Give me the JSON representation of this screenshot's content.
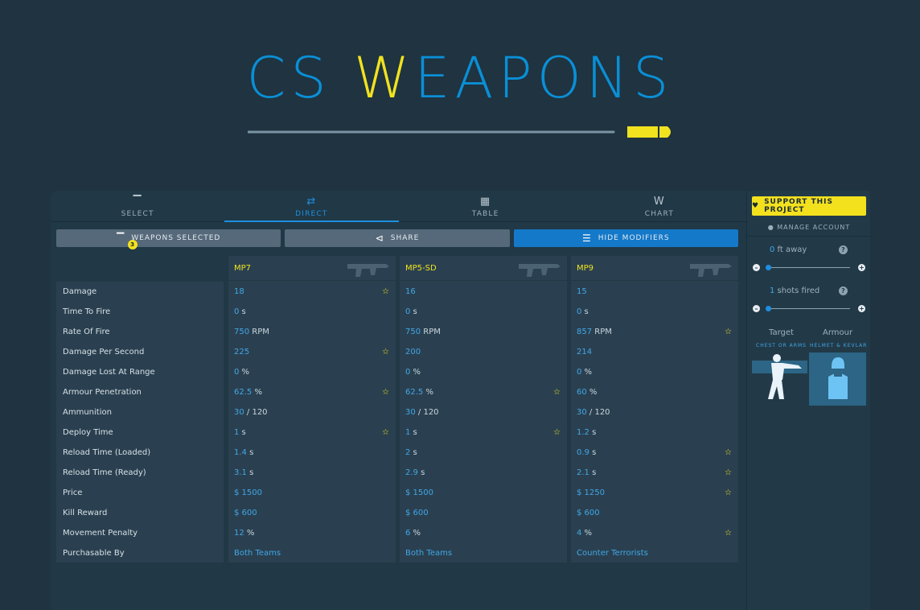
{
  "logo": {
    "part1": "CS ",
    "part2": "W",
    "part3": "EAPONS"
  },
  "tabs": [
    {
      "label": "SELECT",
      "icon": "pistol-icon"
    },
    {
      "label": "DIRECT",
      "icon": "swap-icon"
    },
    {
      "label": "TABLE",
      "icon": "grid-icon"
    },
    {
      "label": "CHART",
      "icon": "chart-w-icon"
    }
  ],
  "active_tab": "DIRECT",
  "actions": {
    "weapons_selected": "WEAPONS SELECTED",
    "weapons_count": "3",
    "share": "SHARE",
    "hide_modifiers": "HIDE MODIFIERS"
  },
  "labels": [
    "Damage",
    "Time To Fire",
    "Rate Of Fire",
    "Damage Per Second",
    "Damage Lost At Range",
    "Armour Penetration",
    "Ammunition",
    "Deploy Time",
    "Reload Time (Loaded)",
    "Reload Time (Ready)",
    "Price",
    "Kill Reward",
    "Movement Penalty",
    "Purchasable By"
  ],
  "weapons": [
    {
      "name": "MP7",
      "rows": [
        {
          "v": "18",
          "u": "",
          "star": true
        },
        {
          "v": "0",
          "u": " s",
          "star": false
        },
        {
          "v": "750",
          "u": " RPM",
          "star": false
        },
        {
          "v": "225",
          "u": "",
          "star": true
        },
        {
          "v": "0",
          "u": " %",
          "star": false
        },
        {
          "v": "62.5",
          "u": " %",
          "star": true
        },
        {
          "v": "30",
          "u": " / 120",
          "star": false
        },
        {
          "v": "1",
          "u": " s",
          "star": true
        },
        {
          "v": "1.4",
          "u": " s",
          "star": false
        },
        {
          "v": "3.1",
          "u": " s",
          "star": false
        },
        {
          "v": "$ 1500",
          "u": "",
          "star": false,
          "pre": true
        },
        {
          "v": "$ 600",
          "u": "",
          "star": false,
          "pre": true
        },
        {
          "v": "12",
          "u": " %",
          "star": false
        },
        {
          "v": "Both Teams",
          "u": "",
          "star": false
        }
      ]
    },
    {
      "name": "MP5-SD",
      "rows": [
        {
          "v": "16",
          "u": "",
          "star": false
        },
        {
          "v": "0",
          "u": " s",
          "star": false
        },
        {
          "v": "750",
          "u": " RPM",
          "star": false
        },
        {
          "v": "200",
          "u": "",
          "star": false
        },
        {
          "v": "0",
          "u": " %",
          "star": false
        },
        {
          "v": "62.5",
          "u": " %",
          "star": true
        },
        {
          "v": "30",
          "u": " / 120",
          "star": false
        },
        {
          "v": "1",
          "u": " s",
          "star": true
        },
        {
          "v": "2",
          "u": " s",
          "star": false
        },
        {
          "v": "2.9",
          "u": " s",
          "star": false
        },
        {
          "v": "$ 1500",
          "u": "",
          "star": false
        },
        {
          "v": "$ 600",
          "u": "",
          "star": false
        },
        {
          "v": "6",
          "u": " %",
          "star": false
        },
        {
          "v": "Both Teams",
          "u": "",
          "star": false
        }
      ]
    },
    {
      "name": "MP9",
      "rows": [
        {
          "v": "15",
          "u": "",
          "star": false
        },
        {
          "v": "0",
          "u": " s",
          "star": false
        },
        {
          "v": "857",
          "u": " RPM",
          "star": true
        },
        {
          "v": "214",
          "u": "",
          "star": false
        },
        {
          "v": "0",
          "u": " %",
          "star": false
        },
        {
          "v": "60",
          "u": " %",
          "star": false
        },
        {
          "v": "30",
          "u": " / 120",
          "star": false
        },
        {
          "v": "1.2",
          "u": " s",
          "star": false
        },
        {
          "v": "0.9",
          "u": " s",
          "star": true
        },
        {
          "v": "2.1",
          "u": " s",
          "star": true
        },
        {
          "v": "$ 1250",
          "u": "",
          "star": true
        },
        {
          "v": "$ 600",
          "u": "",
          "star": false
        },
        {
          "v": "4",
          "u": " %",
          "star": true
        },
        {
          "v": "Counter Terrorists",
          "u": "",
          "star": false
        }
      ]
    }
  ],
  "side": {
    "support": "SUPPORT THIS PROJECT",
    "manage_account": "MANAGE ACCOUNT",
    "distance_value": "0",
    "distance_unit": " ft away",
    "shots_value": "1",
    "shots_unit": " shots fired",
    "target_label": "Target",
    "armour_label": "Armour",
    "target_caption": "CHEST OR ARMS",
    "armour_caption": "HELMET & KEVLAR"
  },
  "colors": {
    "accent": "#1d8fe0",
    "highlight": "#f0e21f",
    "background": "#1f3340"
  }
}
